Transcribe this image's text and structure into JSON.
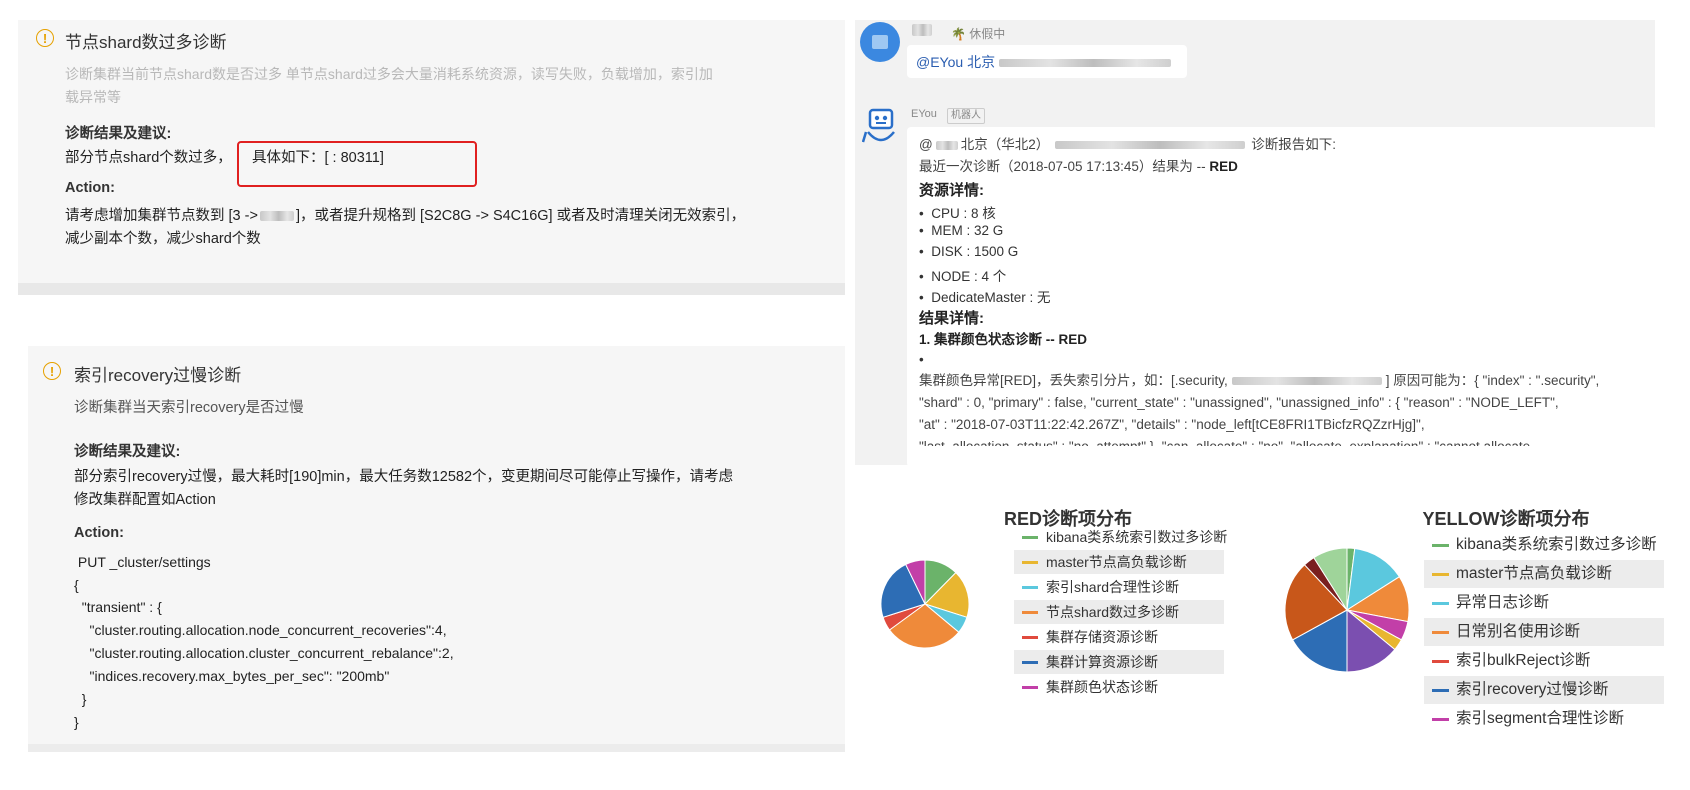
{
  "panel1": {
    "title": "节点shard数过多诊断",
    "desc_line1": "诊断集群当前节点shard数是否过多 单节点shard过多会大量消耗系统资源，读写失败，负载增加，索引加",
    "desc_line2": "载异常等",
    "result_heading": "诊断结果及建议:",
    "result_text": "部分节点shard个数过多，",
    "result_highlight": "具体如下：[ : 80311]",
    "action_heading": "Action:",
    "action_line1": "请考虑增加集群节点数到 [3 ->",
    "action_line1b": "]，或者提升规格到 [S2C8G -> S4C16G] 或者及时清理关闭无效索引，",
    "action_line2": "减少副本个数，减少shard个数"
  },
  "panel2": {
    "title": "索引recovery过慢诊断",
    "desc": "诊断集群当天索引recovery是否过慢",
    "result_heading": "诊断结果及建议:",
    "result_line1": " 部分索引recovery过慢，最大耗时[190]min，最大任务数12582个，变更期间尽可能停止写操作，请考虑",
    "result_line2": "修改集群配置如Action",
    "action_heading": "Action:",
    "code": [
      " PUT _cluster/settings",
      "{",
      "  \"transient\" : {",
      "    \"cluster.routing.allocation.node_concurrent_recoveries\":4,",
      "    \"cluster.routing.allocation.cluster_concurrent_rebalance\":2,",
      "    \"indices.recovery.max_bytes_per_sec\": \"200mb\"",
      "  }",
      "}"
    ]
  },
  "chat": {
    "status": "休假中",
    "msg1_prefix": "@EYou 北京",
    "bot_name": "EYou",
    "bot_tag": "机器人",
    "line_at": "@",
    "line_region": "北京（华北2）",
    "line_report": "诊断报告如下:",
    "line_recent": "最近一次诊断（2018-07-05 17:13:45）结果为 --",
    "line_recent_status": "RED",
    "resource_heading": "资源详情:",
    "resources": [
      "CPU : 8 核",
      "MEM : 32 G",
      "DISK : 1500 G",
      "NODE : 4 个",
      "DedicateMaster : 无"
    ],
    "result_heading": "结果详情:",
    "item1": "1. 集群颜色状态诊断",
    "item1_status": "-- RED",
    "detail_line1a": "集群颜色异常[RED]，丢失索引分片，如：[.security,",
    "detail_line1b": "] 原因可能为：{ \"index\" : \".security\",",
    "detail_line2": "\"shard\" : 0, \"primary\" : false, \"current_state\" : \"unassigned\", \"unassigned_info\" : { \"reason\" : \"NODE_LEFT\",",
    "detail_line3": "\"at\" : \"2018-07-03T11:22:42.267Z\", \"details\" : \"node_left[tCE8FRI1TBicfzRQZzrHjg]\",",
    "detail_line4": "\"last_allocation_status\" : \"no_attempt\" }, \"can_allocate\" : \"no\", \"allocate_explanation\" : \"cannot allocate"
  },
  "chart_data": [
    {
      "type": "pie",
      "title": "RED诊断项分布",
      "categories": [
        "kibana类系统索引数过多诊断",
        "master节点高负载诊断",
        "索引shard合理性诊断",
        "节点shard数过多诊断",
        "集群存储资源诊断",
        "集群计算资源诊断",
        "集群颜色状态诊断"
      ],
      "values": [
        12,
        17,
        6,
        28,
        5,
        22,
        7
      ],
      "colors": [
        "#6bb36a",
        "#e8b630",
        "#5bc8de",
        "#ef8a3a",
        "#e04a3d",
        "#2d6db5",
        "#c23fa8"
      ],
      "legend": "right"
    },
    {
      "type": "pie",
      "title": "YELLOW诊断项分布",
      "categories": [
        "kibana类系统索引数过多诊断",
        "master节点高负载诊断",
        "异常日志诊断",
        "日常别名使用诊断",
        "索引bulkReject诊断",
        "索引recovery过慢诊断",
        "索引segment合理性诊断"
      ],
      "values": [
        2,
        0,
        14,
        12,
        5,
        3,
        14,
        17,
        21,
        3,
        9
      ],
      "colors": [
        "#6bb36a",
        "#e8b630",
        "#5bc8de",
        "#ef8a3a",
        "#c23fa8",
        "#e8b630",
        "#7b4fb0",
        "#2d6db5",
        "#c8571a",
        "#7a1f1f",
        "#9fd49a"
      ],
      "legend": "right",
      "legend_colors": [
        "#6bb36a",
        "#e8b630",
        "#5bc8de",
        "#ef8a3a",
        "#e04a3d",
        "#2d6db5",
        "#c23fa8"
      ]
    }
  ]
}
